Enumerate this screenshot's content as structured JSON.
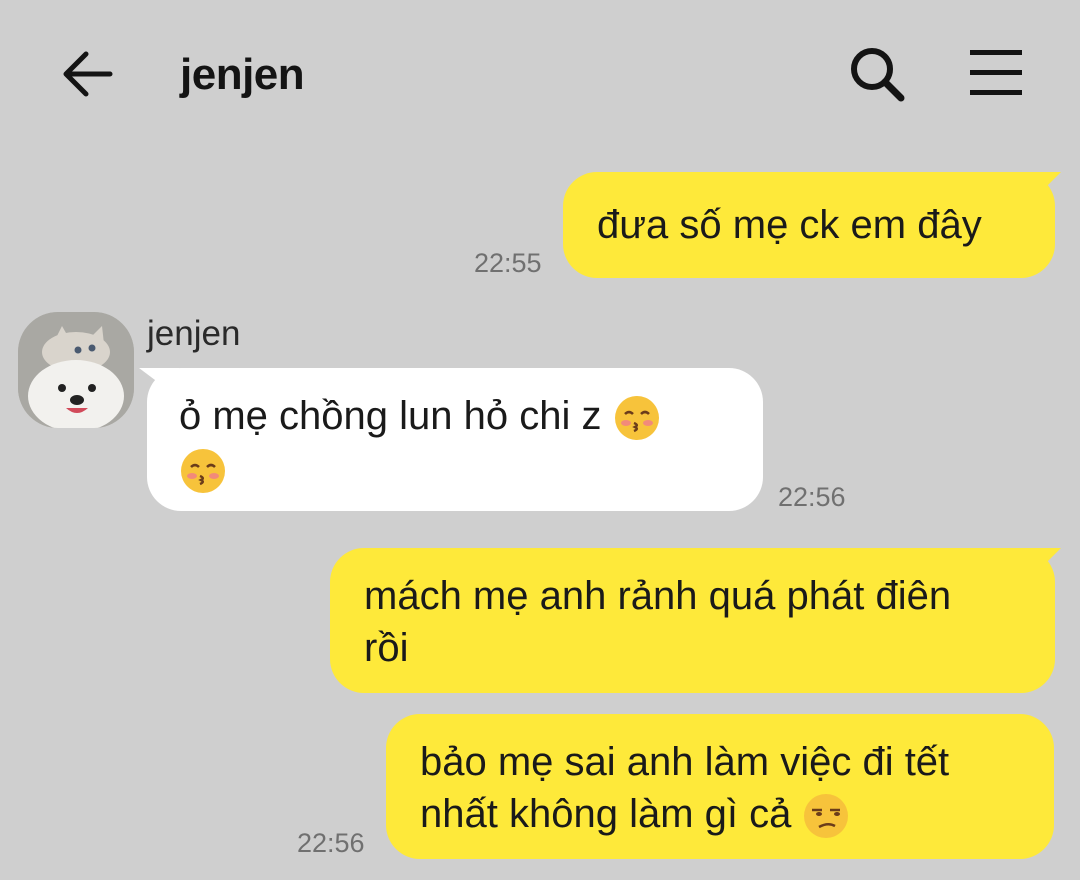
{
  "header": {
    "back_icon": "back-arrow-icon",
    "title": "jenjen",
    "search_icon": "search-icon",
    "menu_icon": "hamburger-menu-icon"
  },
  "messages": [
    {
      "sender": "me",
      "text": "đưa số mẹ ck em đây",
      "time": "22:55"
    },
    {
      "sender": "jenjen",
      "sender_name": "jenjen",
      "text": "ỏ mẹ chồng lun hỏ chi z",
      "emoji": "kissing-face-with-closed-eyes",
      "time": "22:56"
    },
    {
      "sender": "me",
      "text_line1": "mách mẹ anh rảnh quá phát điên",
      "text_line2": "rồi"
    },
    {
      "sender": "me",
      "text_line1": "bảo mẹ sai anh làm việc đi tết",
      "text_line2": "nhất không làm gì cả",
      "emoji": "unamused-face",
      "time": "22:56"
    }
  ],
  "colors": {
    "background": "#cfcfcf",
    "my_bubble": "#fee93a",
    "their_bubble": "#ffffff",
    "time_text": "#707070"
  }
}
